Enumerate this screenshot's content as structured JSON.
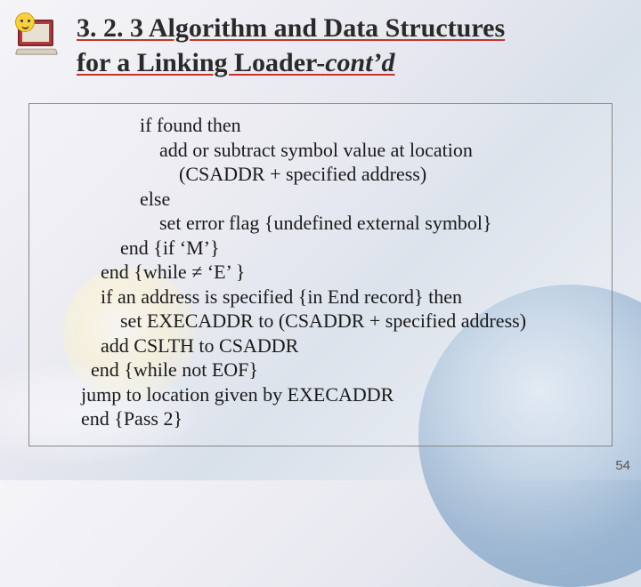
{
  "heading": {
    "line1": "3. 2. 3 Algorithm and Data Structures",
    "line2_prefix": "for a Linking Loader-",
    "line2_contd": "cont’d"
  },
  "pseudocode": "            if found then\n                add or subtract symbol value at location\n                    (CSADDR + specified address)\n            else\n                set error flag {undefined external symbol}\n        end {if ‘M’}\n    end {while ≠ ‘E’ }\n    if an address is specified {in End record} then\n        set EXECADDR to (CSADDR + specified address)\n    add CSLTH to CSADDR\n  end {while not EOF}\njump to location given by EXECADDR\nend {Pass 2}",
  "page_number": "54"
}
